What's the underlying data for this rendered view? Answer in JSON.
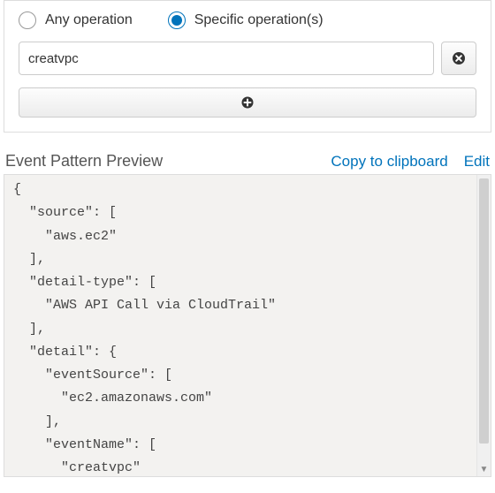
{
  "radio": {
    "any_label": "Any operation",
    "specific_label": "Specific operation(s)",
    "selected": "specific"
  },
  "operation_input": {
    "value": "creatvpc",
    "placeholder": ""
  },
  "preview": {
    "title": "Event Pattern Preview",
    "copy_label": "Copy to clipboard",
    "edit_label": "Edit",
    "code": "{\n  \"source\": [\n    \"aws.ec2\"\n  ],\n  \"detail-type\": [\n    \"AWS API Call via CloudTrail\"\n  ],\n  \"detail\": {\n    \"eventSource\": [\n      \"ec2.amazonaws.com\"\n    ],\n    \"eventName\": [\n      \"creatvpc\"\n    ]"
  }
}
